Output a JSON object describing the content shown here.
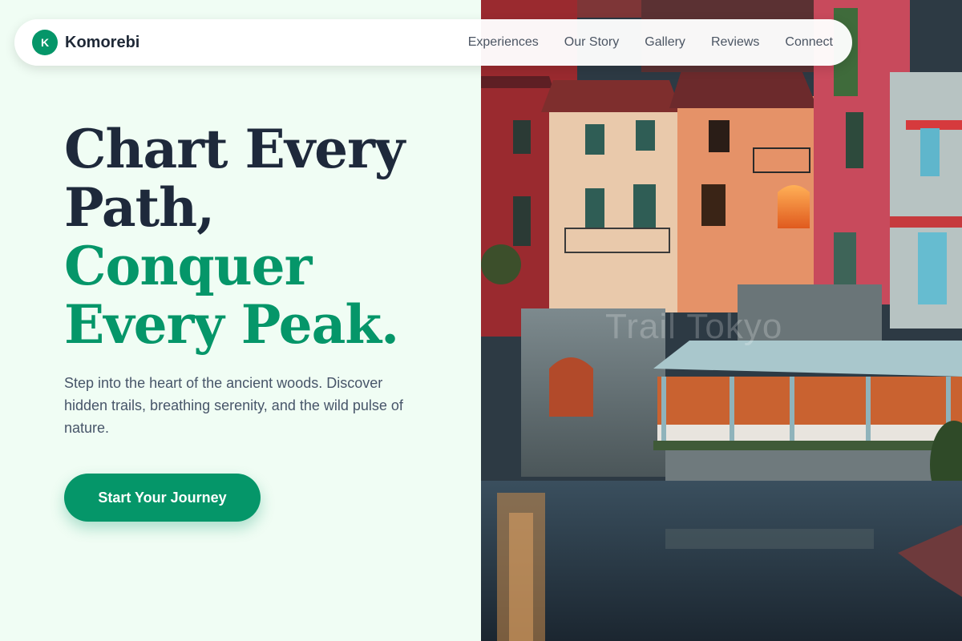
{
  "brand": {
    "initial": "K",
    "name": "Komorebi"
  },
  "nav": {
    "items": [
      {
        "label": "Experiences"
      },
      {
        "label": "Our Story"
      },
      {
        "label": "Gallery"
      },
      {
        "label": "Reviews"
      },
      {
        "label": "Connect"
      }
    ]
  },
  "hero": {
    "headline_line1": "Chart Every",
    "headline_line2": "Path,",
    "headline_line3": "Conquer",
    "headline_line4": "Every Peak.",
    "tagline": "Step into the heart of the ancient woods. Discover hidden trails, breathing serenity, and the wild pulse of nature.",
    "cta_label": "Start Your Journey"
  },
  "image": {
    "watermark": "Trail Tokyo"
  },
  "colors": {
    "accent": "#059669",
    "headline_dark": "#1e293b",
    "background": "#f0fdf4",
    "text_muted": "#475569"
  }
}
